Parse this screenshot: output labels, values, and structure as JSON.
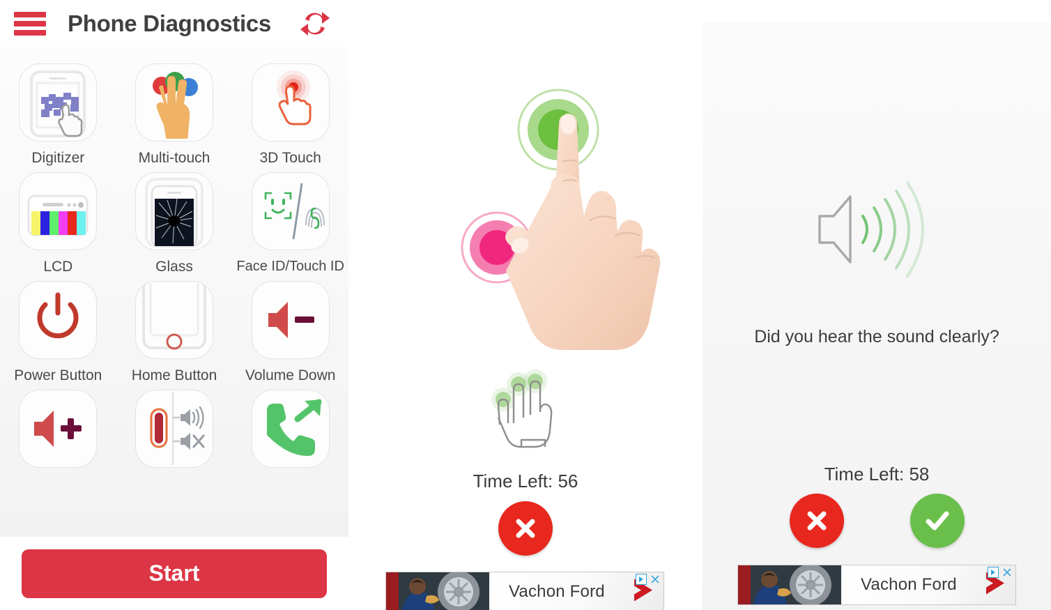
{
  "app": {
    "title": "Phone Diagnostics",
    "menu_icon": "hamburger-menu-icon",
    "refresh_icon": "refresh-icon",
    "accent_red": "#dc3545",
    "start_label": "Start"
  },
  "tests": [
    {
      "label": "Digitizer",
      "icon": "digitizer-icon"
    },
    {
      "label": "Multi-touch",
      "icon": "multi-touch-icon"
    },
    {
      "label": "3D Touch",
      "icon": "3d-touch-icon"
    },
    {
      "label": "LCD",
      "icon": "lcd-icon"
    },
    {
      "label": "Glass",
      "icon": "glass-icon"
    },
    {
      "label": "Face ID/Touch ID",
      "icon": "face-id-touch-id-icon"
    },
    {
      "label": "Power Button",
      "icon": "power-button-icon"
    },
    {
      "label": "Home Button",
      "icon": "home-button-icon"
    },
    {
      "label": "Volume Down",
      "icon": "volume-down-icon"
    },
    {
      "label": "",
      "icon": "volume-up-icon"
    },
    {
      "label": "",
      "icon": "mute-switch-icon"
    },
    {
      "label": "",
      "icon": "outgoing-call-icon"
    }
  ],
  "lcd_bar_colors": [
    "#f5f36a",
    "#2a22e0",
    "#5ef06a",
    "#f23df2",
    "#e8271e",
    "#6cf0f0"
  ],
  "touch_test": {
    "hand_illustration": "touch-hand-illustration",
    "targets": [
      {
        "name": "green-touch-target",
        "color": "#6cbf3f",
        "mid": "#a8d98a",
        "ring": "#bfe0a8"
      },
      {
        "name": "pink-touch-target",
        "color": "#f0277f",
        "mid": "#f57eb0",
        "ring": "#f7a8c8"
      }
    ],
    "hint_icon": "three-finger-hand-icon",
    "time_left": "Time Left: 56",
    "fail_icon": "x-mark-icon",
    "fail_color": "#e8281e"
  },
  "sound_test": {
    "speaker_icon": "speaker-sound-waves-icon",
    "question": "Did you hear the sound clearly?",
    "time_left": "Time Left: 58",
    "fail_icon": "x-mark-icon",
    "pass_icon": "check-mark-icon",
    "fail_color": "#e8281e",
    "pass_color": "#6abf4b"
  },
  "ads": [
    {
      "advertiser": "Vachon Ford",
      "info_icon": "ad-choices-icon",
      "close_icon": "close-icon"
    },
    {
      "advertiser": "Vachon Ford",
      "info_icon": "ad-choices-icon",
      "close_icon": "close-icon"
    }
  ]
}
